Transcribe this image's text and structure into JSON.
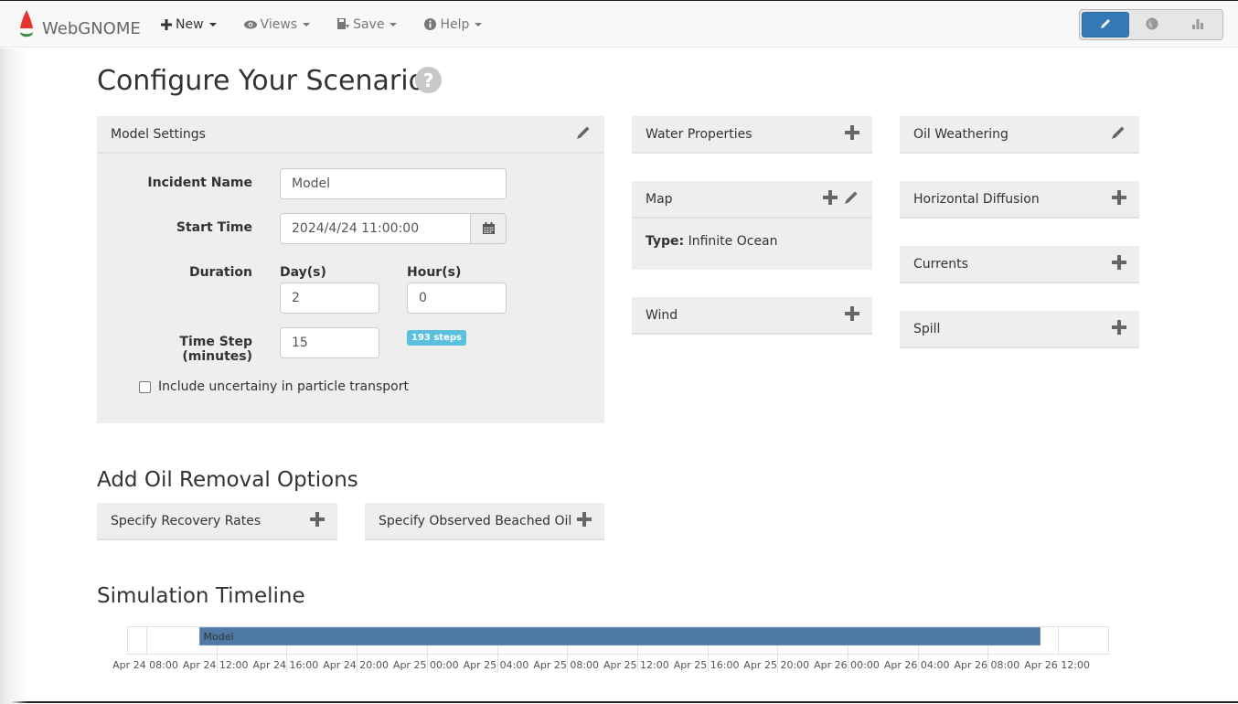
{
  "navbar": {
    "brand": "WebGNOME",
    "menu": [
      {
        "label": "New",
        "icon": "plus-icon"
      },
      {
        "label": "Views",
        "icon": "eye-icon"
      },
      {
        "label": "Save",
        "icon": "save-icon"
      },
      {
        "label": "Help",
        "icon": "info-circle-icon"
      }
    ],
    "view_toggle": [
      {
        "name": "setup-view",
        "icon": "pencil-icon",
        "active": true
      },
      {
        "name": "map-view",
        "icon": "globe-icon",
        "active": false
      },
      {
        "name": "fate-view",
        "icon": "bar-chart-icon",
        "active": false
      }
    ],
    "accent": "#337ab7"
  },
  "page": {
    "title": "Configure Your Scenario",
    "help_icon": "question-circle-icon"
  },
  "model_settings": {
    "title": "Model Settings",
    "incident_name_label": "Incident Name",
    "incident_name_value": "Model",
    "start_time_label": "Start Time",
    "start_time_value": "2024/4/24 11:00:00",
    "duration_label": "Duration",
    "days_label": "Day(s)",
    "days_value": "2",
    "hours_label": "Hour(s)",
    "hours_value": "0",
    "time_step_label": "Time Step (minutes)",
    "time_step_value": "15",
    "steps_badge": "193 steps",
    "uncertainty_label": "Include uncertainy in particle transport",
    "uncertainty_checked": false
  },
  "panels": {
    "water_properties": "Water Properties",
    "map": {
      "title": "Map",
      "type_label": "Type:",
      "type_value": "Infinite Ocean"
    },
    "wind": "Wind",
    "oil_weathering": "Oil Weathering",
    "horizontal_diffusion": "Horizontal Diffusion",
    "currents": "Currents",
    "spill": "Spill"
  },
  "oil_removal": {
    "title": "Add Oil Removal Options",
    "recovery_rates": "Specify Recovery Rates",
    "beached_oil": "Specify Observed Beached Oil"
  },
  "timeline": {
    "title": "Simulation Timeline",
    "bar_label": "Model",
    "bar_color": "#4f79a5",
    "start": "Apr 24 11:00",
    "end": "Apr 26 11:00",
    "axis_start_hours": 6,
    "axis_end_hours": 62,
    "ticks": [
      "Apr 24 08:00",
      "Apr 24 12:00",
      "Apr 24 16:00",
      "Apr 24 20:00",
      "Apr 25 00:00",
      "Apr 25 04:00",
      "Apr 25 08:00",
      "Apr 25 12:00",
      "Apr 25 16:00",
      "Apr 25 20:00",
      "Apr 26 00:00",
      "Apr 26 04:00",
      "Apr 26 08:00",
      "Apr 26 12:00"
    ]
  }
}
